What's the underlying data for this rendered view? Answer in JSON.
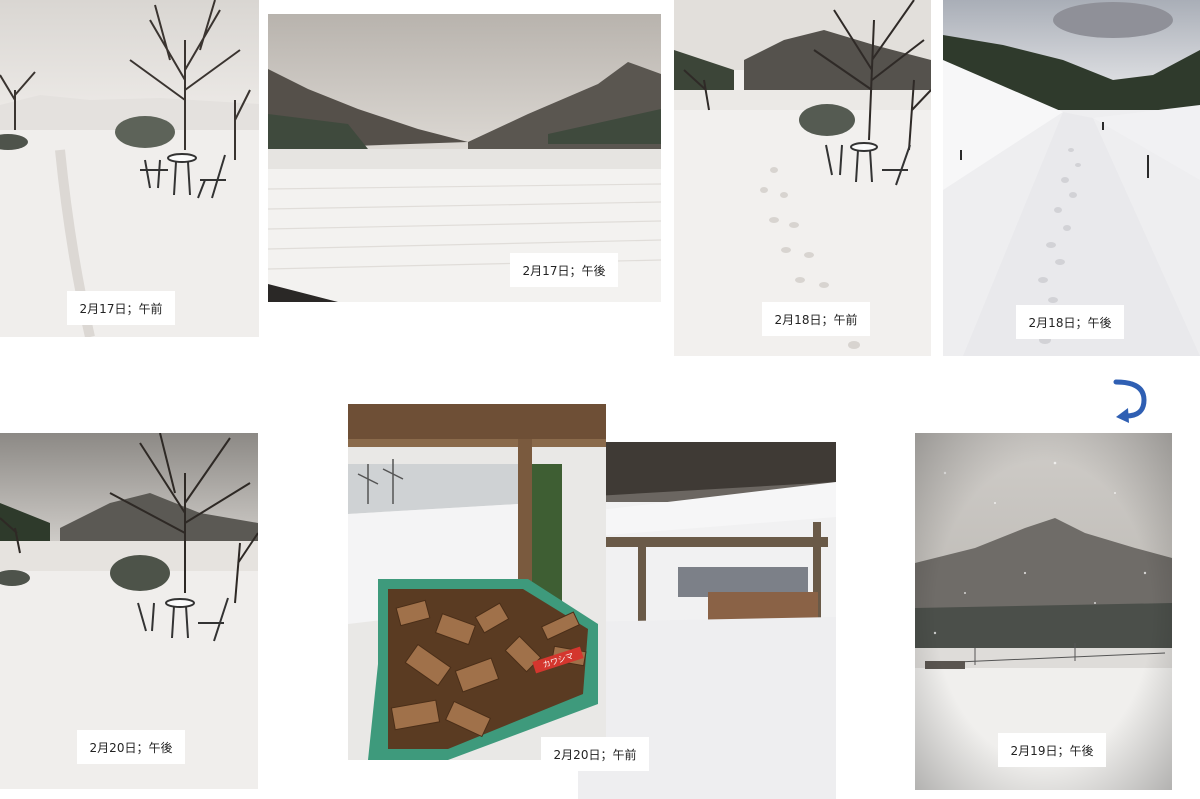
{
  "photos": [
    {
      "caption": "2月17日；午前"
    },
    {
      "caption": "2月17日；午後"
    },
    {
      "caption": "2月18日；午前"
    },
    {
      "caption": "2月18日；午後"
    },
    {
      "caption": "2月20日；午後"
    },
    {
      "caption": "2月20日；午前"
    },
    {
      "caption": "2月19日；午後"
    }
  ],
  "trailer_sign": "カワシマ",
  "colors": {
    "arrow": "#2f5fb3",
    "snow": "#f2f0ee",
    "trailer": "#3e9a7c"
  }
}
